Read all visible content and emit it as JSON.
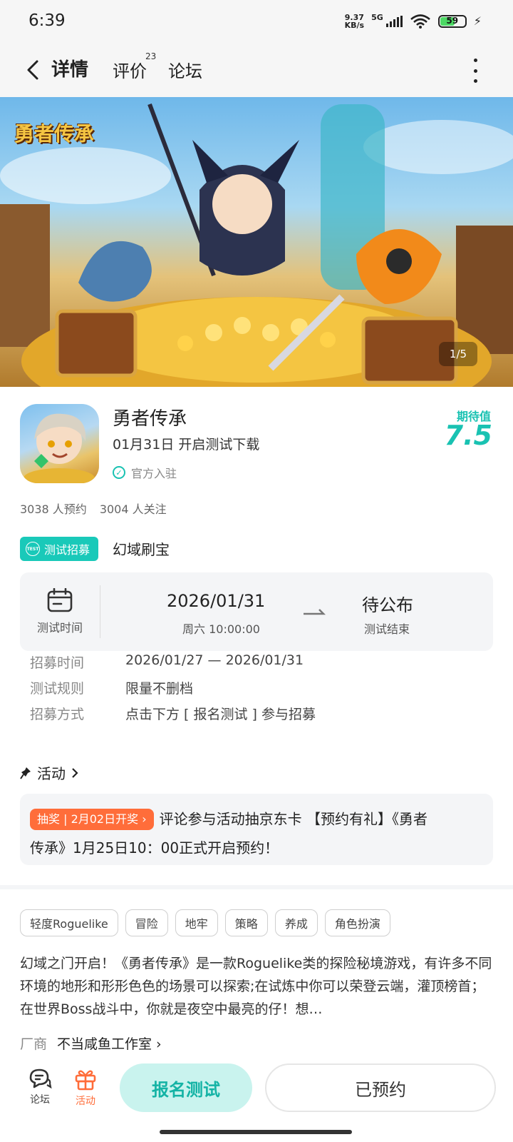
{
  "status_bar": {
    "time": "6:39",
    "net_speed_value": "9.37",
    "net_speed_unit": "KB/s",
    "network": "5G",
    "battery": "59"
  },
  "nav": {
    "tabs": [
      {
        "label": "详情",
        "active": true
      },
      {
        "label": "评价",
        "badge": "23"
      },
      {
        "label": "论坛"
      }
    ]
  },
  "banner": {
    "logo_text": "勇者传承",
    "counter": "1/5"
  },
  "game": {
    "title": "勇者传承",
    "date_line": "01月31日 开启测试下载",
    "official": "官方入驻",
    "expect_label": "期待值",
    "expect_value": "7.5",
    "reservations": "3038 人预约",
    "followers": "3004 人关注"
  },
  "recruit": {
    "badge": "测试招募",
    "badge_icon": "TEST",
    "name": "幻域刷宝"
  },
  "test_time": {
    "label": "测试时间",
    "start_date": "2026/01/31",
    "start_sub": "周六  10:00:00",
    "end_status": "待公布",
    "end_sub": "测试结束"
  },
  "info": [
    {
      "key": "招募时间",
      "value": "2026/01/27 — 2026/01/31"
    },
    {
      "key": "测试规则",
      "value": "限量不删档"
    },
    {
      "key": "招募方式",
      "value": "点击下方 [ 报名测试 ] 参与招募"
    }
  ],
  "activity": {
    "heading": "活动",
    "tag": "抽奖 | 2月02日开奖 ›",
    "text_line1": "评论参与活动抽京东卡 【预约有礼】《勇者",
    "text_line2": "传承》1月25日10：00正式开启预约！"
  },
  "tags": [
    "轻度Roguelike",
    "冒险",
    "地牢",
    "策略",
    "养成",
    "角色扮演"
  ],
  "description": "幻域之门开启！《勇者传承》是一款Roguelike类的探险秘境游戏，有许多不同环境的地形和形形色色的场景可以探索;在试炼中你可以荣登云端，灌顶榜首；在世界Boss战斗中，你就是夜空中最亮的仔！想…",
  "vendor": {
    "key": "厂商",
    "value": "不当咸鱼工作室 ›"
  },
  "bottom_bar": {
    "forum": "论坛",
    "activity": "活动",
    "signup": "报名测试",
    "reserved": "已预约"
  },
  "colors": {
    "accent": "#19c2b2",
    "orange": "#ff6d3a"
  }
}
